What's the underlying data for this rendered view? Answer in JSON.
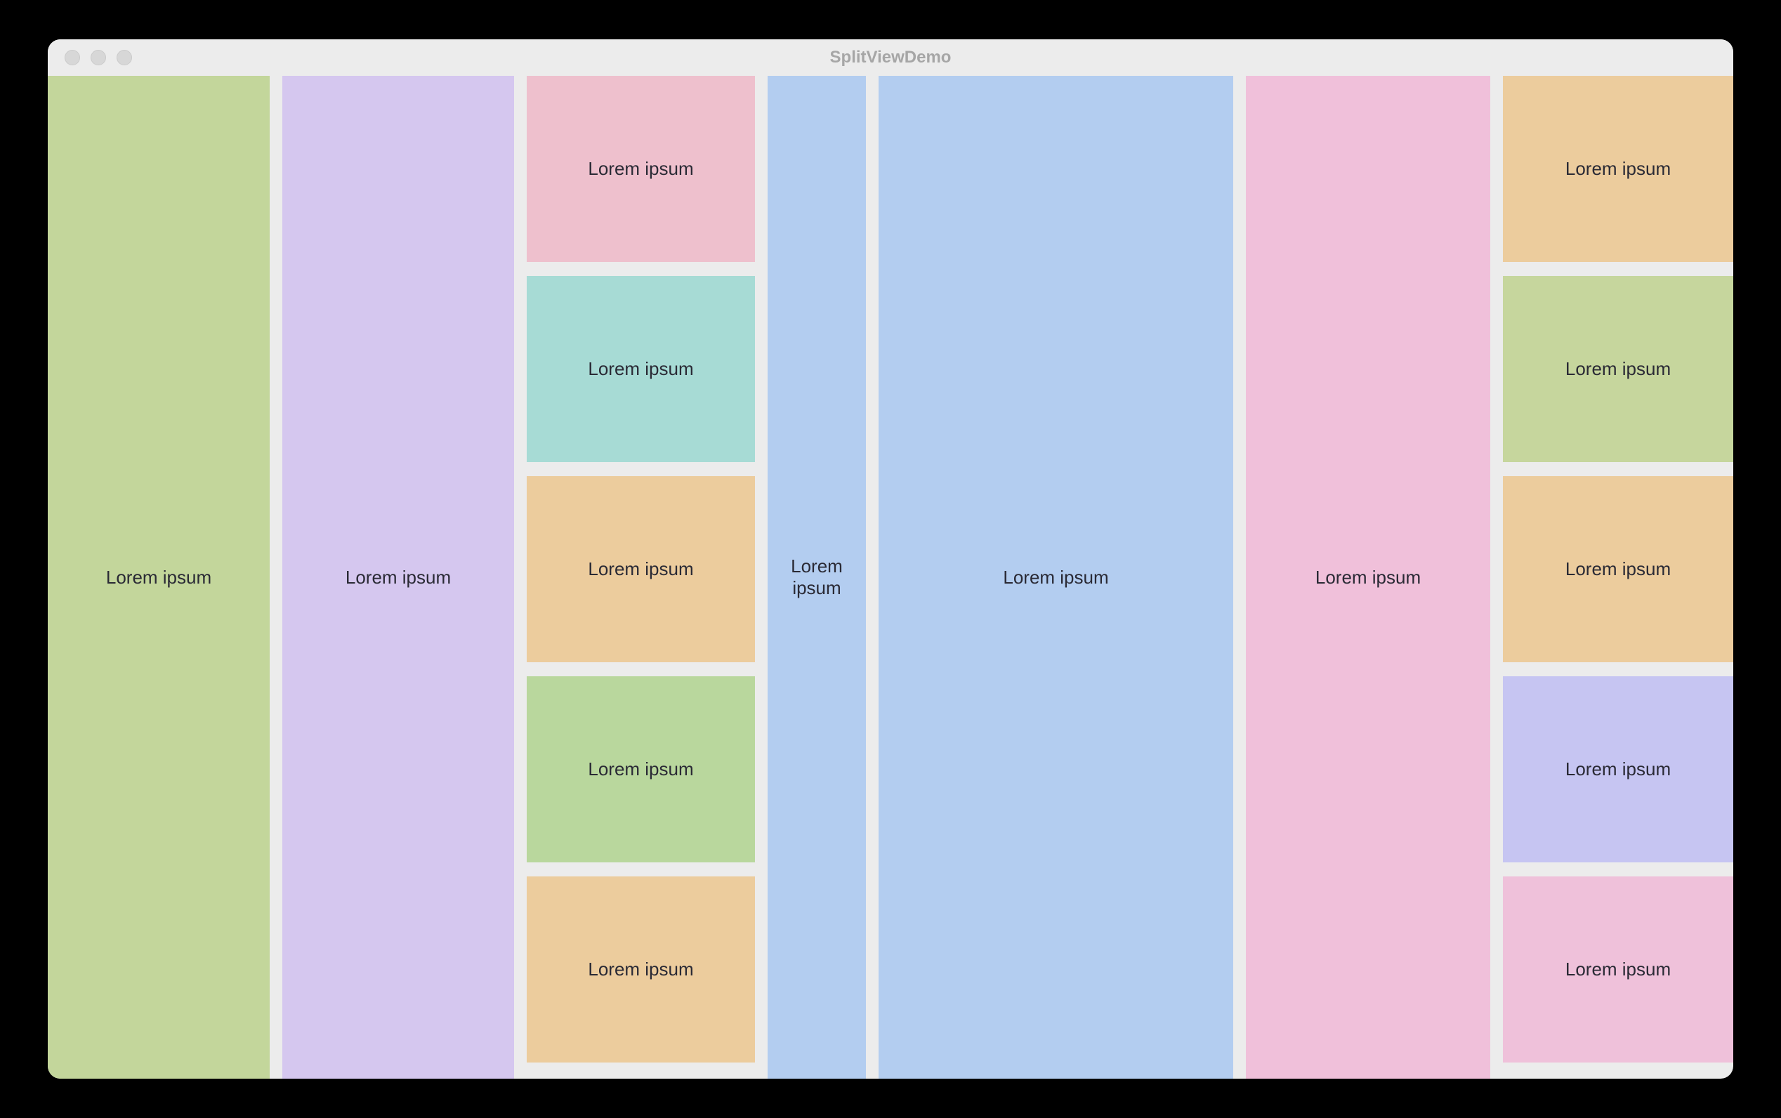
{
  "window": {
    "title": "SplitViewDemo"
  },
  "columns": {
    "col1": {
      "label": "Lorem ipsum"
    },
    "col2": {
      "label": "Lorem ipsum"
    },
    "col3": {
      "items": [
        {
          "label": "Lorem ipsum",
          "color": "c-pink"
        },
        {
          "label": "Lorem ipsum",
          "color": "c-teal"
        },
        {
          "label": "Lorem ipsum",
          "color": "c-orange"
        },
        {
          "label": "Lorem ipsum",
          "color": "c-green"
        },
        {
          "label": "Lorem ipsum",
          "color": "c-orange"
        }
      ]
    },
    "col4": {
      "label": "Lorem ipsum"
    },
    "col5": {
      "label": "Lorem ipsum"
    },
    "col6": {
      "label": "Lorem ipsum"
    },
    "col7": {
      "items": [
        {
          "label": "Lorem ipsum",
          "color": "c-orange"
        },
        {
          "label": "Lorem ipsum",
          "color": "c-olive"
        },
        {
          "label": "Lorem ipsum",
          "color": "c-orange"
        },
        {
          "label": "Lorem ipsum",
          "color": "c-lav"
        },
        {
          "label": "Lorem ipsum",
          "color": "c-rose"
        }
      ]
    }
  }
}
